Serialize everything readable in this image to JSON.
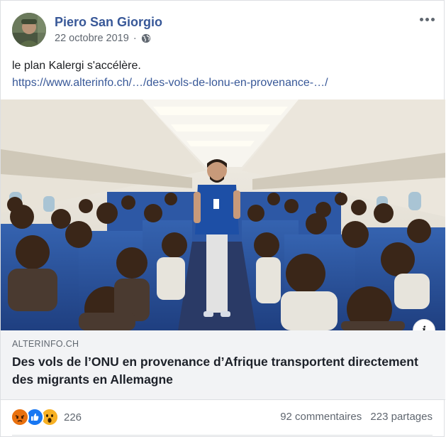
{
  "post": {
    "author": "Piero San Giorgio",
    "date": "22 octobre 2019",
    "privacy_icon": "globe-icon",
    "text": "le plan Kalergi s'accélère.",
    "link_text": "https://www.alterinfo.ch/…/des-vols-de-lonu-en-provenance-…/"
  },
  "link_preview": {
    "domain": "ALTERINFO.CH",
    "title": "Des vols de l’ONU en provenance d’Afrique transportent directement des migrants en Allemagne",
    "info_icon": "i"
  },
  "footer": {
    "reaction_icons": [
      "angry-icon",
      "like-icon",
      "wow-icon"
    ],
    "reaction_count": "226",
    "comments": "92 commentaires",
    "shares": "223 partages"
  },
  "colors": {
    "link": "#385898",
    "secondary_text": "#606770",
    "preview_bg": "#f2f3f5",
    "like_blue": "#1877f2",
    "angry_orange": "#e9710f",
    "wow_yellow": "#f7b125"
  }
}
